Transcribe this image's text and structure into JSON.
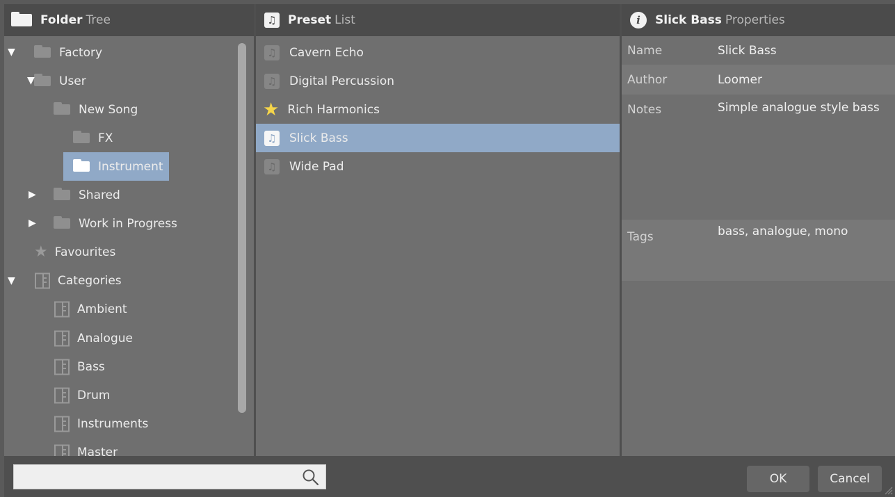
{
  "folder_tree": {
    "header_bold": "Folder",
    "header_light": "Tree",
    "items": [
      {
        "label": "Factory"
      },
      {
        "label": "User"
      },
      {
        "label": "New Song"
      },
      {
        "label": "FX"
      },
      {
        "label": "Instrument"
      },
      {
        "label": "Shared"
      },
      {
        "label": "Work in Progress"
      },
      {
        "label": "Favourites"
      },
      {
        "label": "Categories"
      },
      {
        "label": "Ambient"
      },
      {
        "label": "Analogue"
      },
      {
        "label": "Bass"
      },
      {
        "label": "Drum"
      },
      {
        "label": "Instruments"
      },
      {
        "label": "Master"
      }
    ]
  },
  "preset_list": {
    "header_bold": "Preset",
    "header_light": "List",
    "items": [
      {
        "label": "Cavern Echo"
      },
      {
        "label": "Digital Percussion"
      },
      {
        "label": "Rich Harmonics"
      },
      {
        "label": "Slick Bass"
      },
      {
        "label": "Wide Pad"
      }
    ]
  },
  "properties": {
    "header_bold": "Slick Bass",
    "header_light": "Properties",
    "rows": [
      {
        "label": "Name",
        "value": "Slick Bass"
      },
      {
        "label": "Author",
        "value": "Loomer"
      },
      {
        "label": "Notes",
        "value": "Simple analogue style bass"
      },
      {
        "label": "Tags",
        "value": "bass, analogue, mono"
      }
    ]
  },
  "search": {
    "value": ""
  },
  "buttons": {
    "ok": "OK",
    "cancel": "Cancel"
  },
  "colors": {
    "selection": "#90a9c7",
    "favourite_star": "#f5d54a"
  }
}
